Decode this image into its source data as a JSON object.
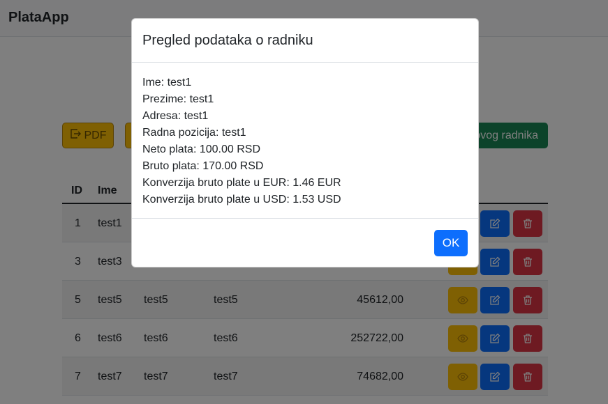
{
  "app": {
    "brand": "PlataApp"
  },
  "toolbar": {
    "pdf_label": "PDF",
    "add_label": "ovog radnika"
  },
  "table": {
    "headers": {
      "id": "ID",
      "ime": "Ime"
    },
    "rows": [
      {
        "id": "1",
        "ime": "test1",
        "prezime": "",
        "adresa": "",
        "neto": ""
      },
      {
        "id": "3",
        "ime": "test3",
        "prezime": "",
        "adresa": "",
        "neto": ""
      },
      {
        "id": "5",
        "ime": "test5",
        "prezime": "test5",
        "adresa": "test5",
        "neto": "45612,00"
      },
      {
        "id": "6",
        "ime": "test6",
        "prezime": "test6",
        "adresa": "test6",
        "neto": "252722,00"
      },
      {
        "id": "7",
        "ime": "test7",
        "prezime": "test7",
        "adresa": "test7",
        "neto": "74682,00"
      }
    ]
  },
  "modal": {
    "title": "Pregled podataka o radniku",
    "lines": [
      "Ime: test1",
      "Prezime: test1",
      "Adresa: test1",
      "Radna pozicija: test1",
      "Neto plata: 100.00 RSD",
      "Bruto plata: 170.00 RSD",
      "Konverzija bruto plate u EUR: 1.46 EUR",
      "Konverzija bruto plate u USD: 1.53 USD"
    ],
    "ok_label": "OK"
  },
  "colors": {
    "warning": "#ffc107",
    "primary": "#0d6efd",
    "danger": "#dc3545",
    "success": "#198754"
  },
  "icons": {
    "pdf": "export-icon",
    "view": "eye-icon",
    "edit": "pencil-square-icon",
    "delete": "trash-icon"
  }
}
